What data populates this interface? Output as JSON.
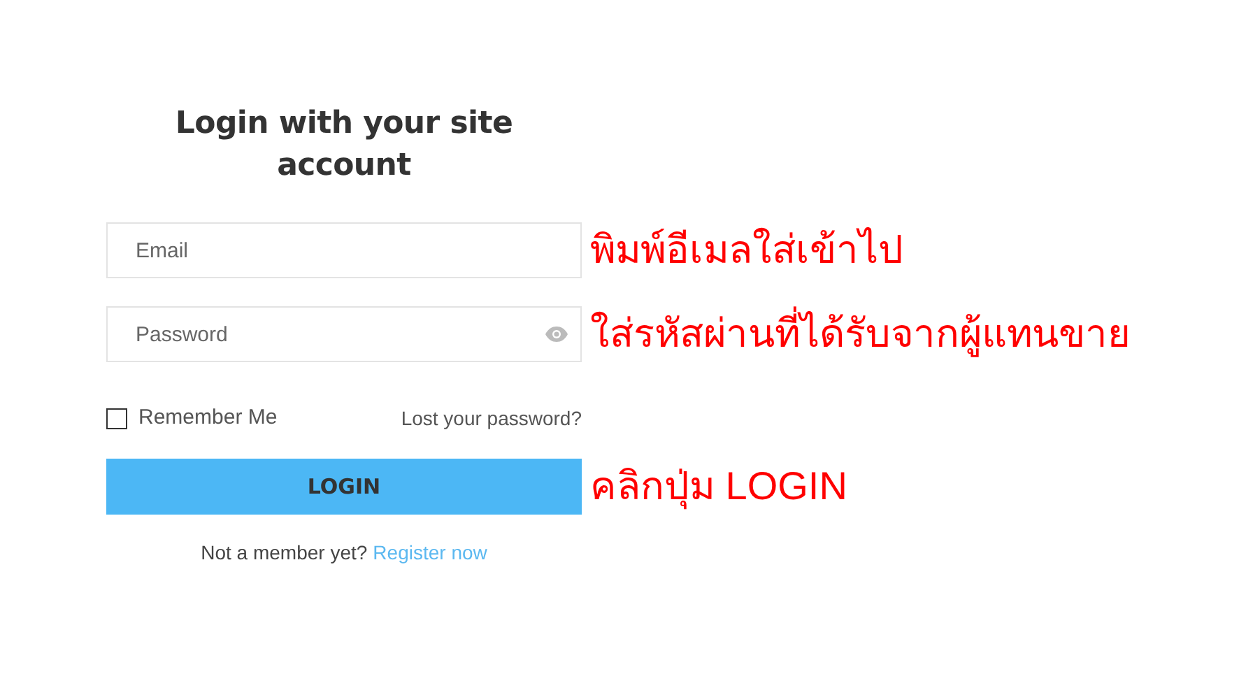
{
  "title": "Login with your site account",
  "email_field": {
    "placeholder": "Email",
    "note": "พิมพ์อีเมลใส่เข้าไป"
  },
  "password_field": {
    "placeholder": "Password",
    "note": "ใส่รหัสผ่านที่ได้รับจากผู้แทนขาย"
  },
  "remember_me": {
    "label": "Remember Me",
    "checked": false
  },
  "lost_password_link": "Lost your password?",
  "login_button": {
    "label": "LOGIN",
    "note": "คลิกปุ่ม LOGIN"
  },
  "footer": {
    "text": "Not a member yet?",
    "link": "Register now"
  }
}
